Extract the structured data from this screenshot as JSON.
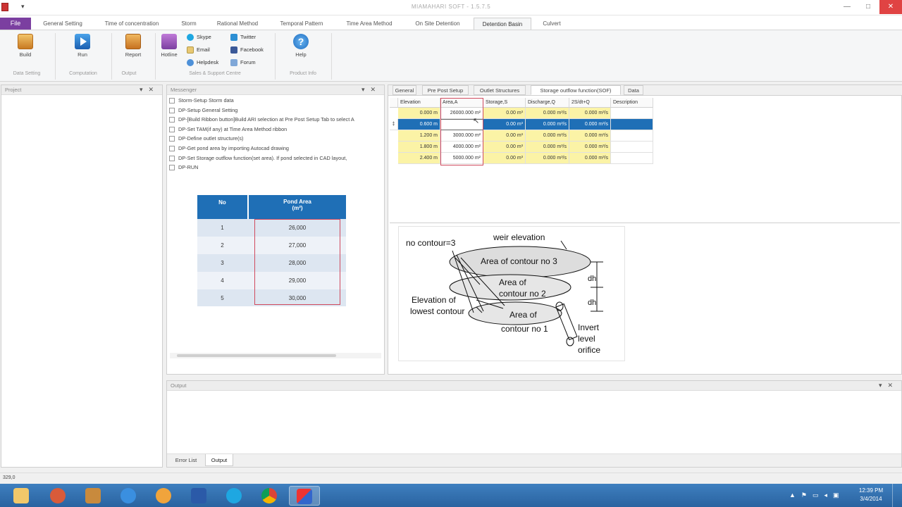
{
  "window": {
    "title": "MIAMAHARI SOFT - 1.5.7.5",
    "quick_access": "▾"
  },
  "ribbon_tabs": [
    {
      "label": "File"
    },
    {
      "label": "General Setting"
    },
    {
      "label": "Time of concentration"
    },
    {
      "label": "Storm"
    },
    {
      "label": "Rational Method"
    },
    {
      "label": "Temporal Pattern"
    },
    {
      "label": "Time Area Method"
    },
    {
      "label": "On Site Detention"
    },
    {
      "label": "Detention Basin"
    },
    {
      "label": "Culvert"
    }
  ],
  "ribbon": {
    "build": "Build",
    "run": "Run",
    "report": "Report",
    "hotline": "Hotline",
    "skype": "Skype",
    "email": "Email",
    "helpdesk": "Helpdesk",
    "twitter": "Twitter",
    "facebook": "Facebook",
    "forum": "Forum",
    "help": "Help",
    "groups": {
      "data_setting": "Data Setting",
      "computation": "Computation",
      "output": "Output",
      "sales": "Sales & Support Centre",
      "product": "Product Info"
    }
  },
  "project_panel": {
    "title": "Project"
  },
  "messenger": {
    "title": "Messenger",
    "items": [
      "Storm-Setup Storm data",
      "DP-Setup General Setting",
      "DP-[Build Ribbon button]Build ARI selection at Pre Post Setup Tab to select A",
      "DP-Set TAM(if any) at Time Area Method ribbon",
      "DP-Define outlet structure(s)",
      "DP-Get pond area by importing Autocad drawing",
      "DP-Set Storage outflow function(set area). If pond selected in CAD layout,",
      "DP-RUN"
    ]
  },
  "pond_table": {
    "headers": [
      "No",
      "Pond Area",
      "(m²)"
    ],
    "rows": [
      {
        "no": "1",
        "area": "26,000"
      },
      {
        "no": "2",
        "area": "27,000"
      },
      {
        "no": "3",
        "area": "28,000"
      },
      {
        "no": "4",
        "area": "29,000"
      },
      {
        "no": "5",
        "area": "30,000"
      }
    ]
  },
  "sub_tabs": [
    "General",
    "Pre Post Setup",
    "Outlet Structures",
    "Storage outflow function(SOF)",
    "Data"
  ],
  "grid": {
    "columns": [
      "Elevation",
      "Area,A",
      "Storage,S",
      "Discharge,Q",
      "2S/dt+Q",
      "Description"
    ],
    "rows": [
      {
        "elev": "0.000 m",
        "area": "26000.000 m²",
        "storage": "0.00 m³",
        "discharge": "0.000 m³/s",
        "fn": "0.000 m³/s",
        "desc": ""
      },
      {
        "elev": "0.600 m",
        "area": "",
        "storage": "0.00 m³",
        "discharge": "0.000 m³/s",
        "fn": "0.000 m³/s",
        "desc": ""
      },
      {
        "elev": "1.200 m",
        "area": "3000.000 m²",
        "storage": "0.00 m³",
        "discharge": "0.000 m³/s",
        "fn": "0.000 m³/s",
        "desc": ""
      },
      {
        "elev": "1.800 m",
        "area": "4000.000 m²",
        "storage": "0.00 m³",
        "discharge": "0.000 m³/s",
        "fn": "0.000 m³/s",
        "desc": ""
      },
      {
        "elev": "2.400 m",
        "area": "5000.000 m²",
        "storage": "0.00 m³",
        "discharge": "0.000 m³/s",
        "fn": "0.000 m³/s",
        "desc": ""
      }
    ]
  },
  "diagram": {
    "no_contour": "no contour=3",
    "weir": "weir elevation",
    "c3": "Area of contour no 3",
    "c2a": "Area of",
    "c2b": "contour no 2",
    "c1a": "Area of",
    "c1b": "contour no 1",
    "low1": "Elevation of",
    "low2": "lowest contour",
    "dh": "dh",
    "inv1": "Invert",
    "inv2": "level",
    "inv3": "orifice"
  },
  "output": {
    "title": "Output",
    "tabs": [
      "Error List",
      "Output"
    ]
  },
  "status": {
    "coord": "329,0"
  },
  "taskbar": {
    "time": "12:39 PM",
    "date": "3/4/2014"
  },
  "colors": {
    "accent": "#1f6fb6",
    "file_tab": "#7b3fa0",
    "selected_row": "#1f6fb6",
    "yellow_cell": "#fbf3a6",
    "taskbar": "#2a63a0"
  }
}
